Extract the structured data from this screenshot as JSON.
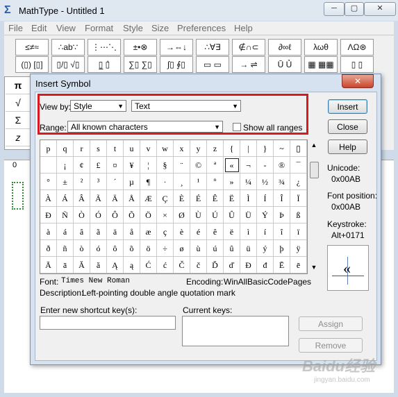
{
  "app": {
    "title": "MathType - Untitled 1",
    "icon": "sigma-icon"
  },
  "menu": [
    "File",
    "Edit",
    "View",
    "Format",
    "Style",
    "Size",
    "Preferences",
    "Help"
  ],
  "palette": {
    "row1": [
      "≤≠≈",
      "∴ab∵",
      "⋮⋯⋱",
      "±•⊗",
      "→⇔↓",
      "∴∀∃",
      "∉∩⊂",
      "∂∞ℓ",
      "λωθ",
      "ΛΩ⊛"
    ],
    "row2": [
      "(▯) [▯]",
      "▯/▯ √▯",
      "▯̲ ▯̇",
      "∑▯ ∑▯",
      "∫▯ ∮▯",
      "▭ ▭",
      "→ ⇌",
      "Ū Ủ",
      "▦ ▦▦",
      "▯ ▯"
    ],
    "left": [
      "π",
      "√",
      "Σ",
      "z"
    ]
  },
  "ruler": {
    "zero_label": "0"
  },
  "dialog": {
    "title": "Insert Symbol",
    "view_by_label": "View by:",
    "view_by_style": "Style",
    "view_by_text": "Text",
    "range_label": "Range:",
    "range_value": "All known characters",
    "show_all_ranges": "Show all ranges",
    "buttons": {
      "insert": "Insert",
      "close": "Close",
      "help": "Help",
      "assign": "Assign",
      "remove": "Remove"
    },
    "unicode_label": "Unicode:",
    "unicode_value": "0x00AB",
    "font_position_label": "Font position:",
    "font_position_value": "0x00AB",
    "keystroke_label": "Keystroke:",
    "keystroke_value": "Alt+0171",
    "font_label": "Font:",
    "font_value": "Times New Roman",
    "encoding_label": "Encoding:",
    "encoding_value": "WinAllBasicCodePages",
    "description_label": "Description:",
    "description_value": "Left-pointing double angle quotation mark",
    "shortcut_label": "Enter new shortcut key(s):",
    "current_keys_label": "Current keys:",
    "preview_glyph": "«",
    "selected_symbol": "«",
    "symbols": [
      [
        "p",
        "q",
        "r",
        "s",
        "t",
        "u",
        "v",
        "w",
        "x",
        "y",
        "z",
        "{",
        "|",
        "}",
        "~",
        "▯"
      ],
      [
        " ",
        "¡",
        "¢",
        "£",
        "¤",
        "¥",
        "¦",
        "§",
        "¨",
        "©",
        "ª",
        "«",
        "¬",
        "-",
        "®",
        "¯"
      ],
      [
        "°",
        "±",
        "²",
        "³",
        "´",
        "µ",
        "¶",
        "·",
        "¸",
        "¹",
        "º",
        "»",
        "¼",
        "½",
        "¾",
        "¿"
      ],
      [
        "À",
        "Á",
        "Â",
        "Ã",
        "Ä",
        "Å",
        "Æ",
        "Ç",
        "È",
        "É",
        "Ê",
        "Ë",
        "Ì",
        "Í",
        "Î",
        "Ï"
      ],
      [
        "Ð",
        "Ñ",
        "Ò",
        "Ó",
        "Ô",
        "Õ",
        "Ö",
        "×",
        "Ø",
        "Ù",
        "Ú",
        "Û",
        "Ü",
        "Ý",
        "Þ",
        "ß"
      ],
      [
        "à",
        "á",
        "â",
        "ã",
        "ä",
        "å",
        "æ",
        "ç",
        "è",
        "é",
        "ê",
        "ë",
        "ì",
        "í",
        "î",
        "ï"
      ],
      [
        "ð",
        "ñ",
        "ò",
        "ó",
        "ô",
        "õ",
        "ö",
        "÷",
        "ø",
        "ù",
        "ú",
        "û",
        "ü",
        "ý",
        "þ",
        "ÿ"
      ],
      [
        "Ā",
        "ā",
        "Ă",
        "ă",
        "Ą",
        "ą",
        "Ć",
        "ć",
        "Č",
        "č",
        "Ď",
        "ď",
        "Đ",
        "đ",
        "Ē",
        "ē"
      ]
    ]
  },
  "watermark": {
    "text": "Baidu经验",
    "sub": "jingyan.baidu.com"
  }
}
